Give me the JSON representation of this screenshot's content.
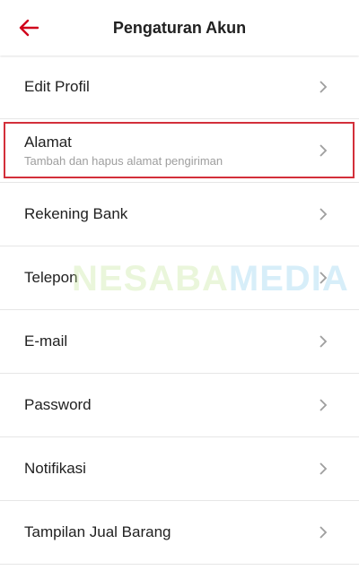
{
  "header": {
    "title": "Pengaturan Akun",
    "back_icon": "arrow-left-icon"
  },
  "items": [
    {
      "label": "Edit Profil"
    },
    {
      "label": "Alamat",
      "sublabel": "Tambah dan hapus alamat pengiriman",
      "highlighted": true
    },
    {
      "label": "Rekening Bank"
    },
    {
      "label": "Telepon"
    },
    {
      "label": "E-mail"
    },
    {
      "label": "Password"
    },
    {
      "label": "Notifikasi"
    },
    {
      "label": "Tampilan Jual Barang"
    }
  ],
  "watermark": {
    "part1": "NESABA",
    "part2": "MEDIA"
  },
  "colors": {
    "accent": "#d0021b",
    "chevron": "#9e9e9e",
    "highlight_border": "#d32f3a",
    "watermark_green": "#c6e89a",
    "watermark_blue": "#8fd0ef"
  }
}
